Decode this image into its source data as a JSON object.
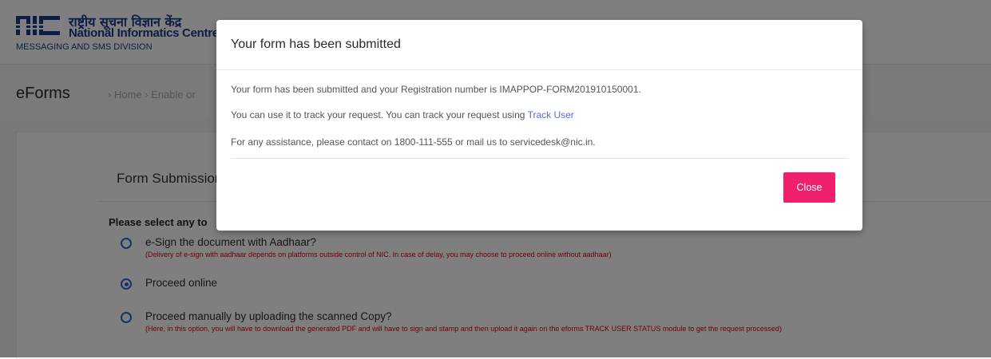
{
  "header": {
    "logo_hindi": "राष्ट्रीय सूचना विज्ञान केंद्र",
    "logo_english": "National Informatics Centre",
    "division": "MESSAGING AND SMS DIVISION"
  },
  "breadcrumb": {
    "title": "eForms",
    "items_text": "›  Home  ›  Enable or"
  },
  "form": {
    "title": "Form Submission",
    "select_label": "Please select any to",
    "options": [
      {
        "label": "e-Sign the document with Aadhaar?",
        "note": "(Delivery of e-sign with aadhaar depends on platforms outside control of NIC. In case of delay, you may choose to proceed online without aadhaar)",
        "selected": false
      },
      {
        "label": "Proceed online",
        "note": "",
        "selected": true
      },
      {
        "label": "Proceed manually by uploading the scanned Copy?",
        "note": "(Here, in this option, you will have to download the generated PDF and will have to sign and stamp and then upload it again on the eforms TRACK USER STATUS module to get the request processed)",
        "selected": false
      }
    ]
  },
  "modal": {
    "title": "Your form has been submitted",
    "line1": "Your form has been submitted and your Registration number is IMAPPOP-FORM201910150001.",
    "line2_prefix": "You can use it to track your request. You can track your request using ",
    "line2_link": "Track User",
    "line3": "For any assistance, please contact on 1800-111-555 or mail us to servicedesk@nic.in.",
    "close_label": "Close"
  },
  "colors": {
    "accent": "#f0206c",
    "radio": "#3a5fc8",
    "link": "#5b6bd5",
    "brand": "#1d3a8a",
    "note": "#e0001b"
  },
  "icons": {
    "logo": "nic-logo-icon",
    "radio_unchecked": "radio-unchecked-icon",
    "radio_checked": "radio-checked-icon"
  }
}
